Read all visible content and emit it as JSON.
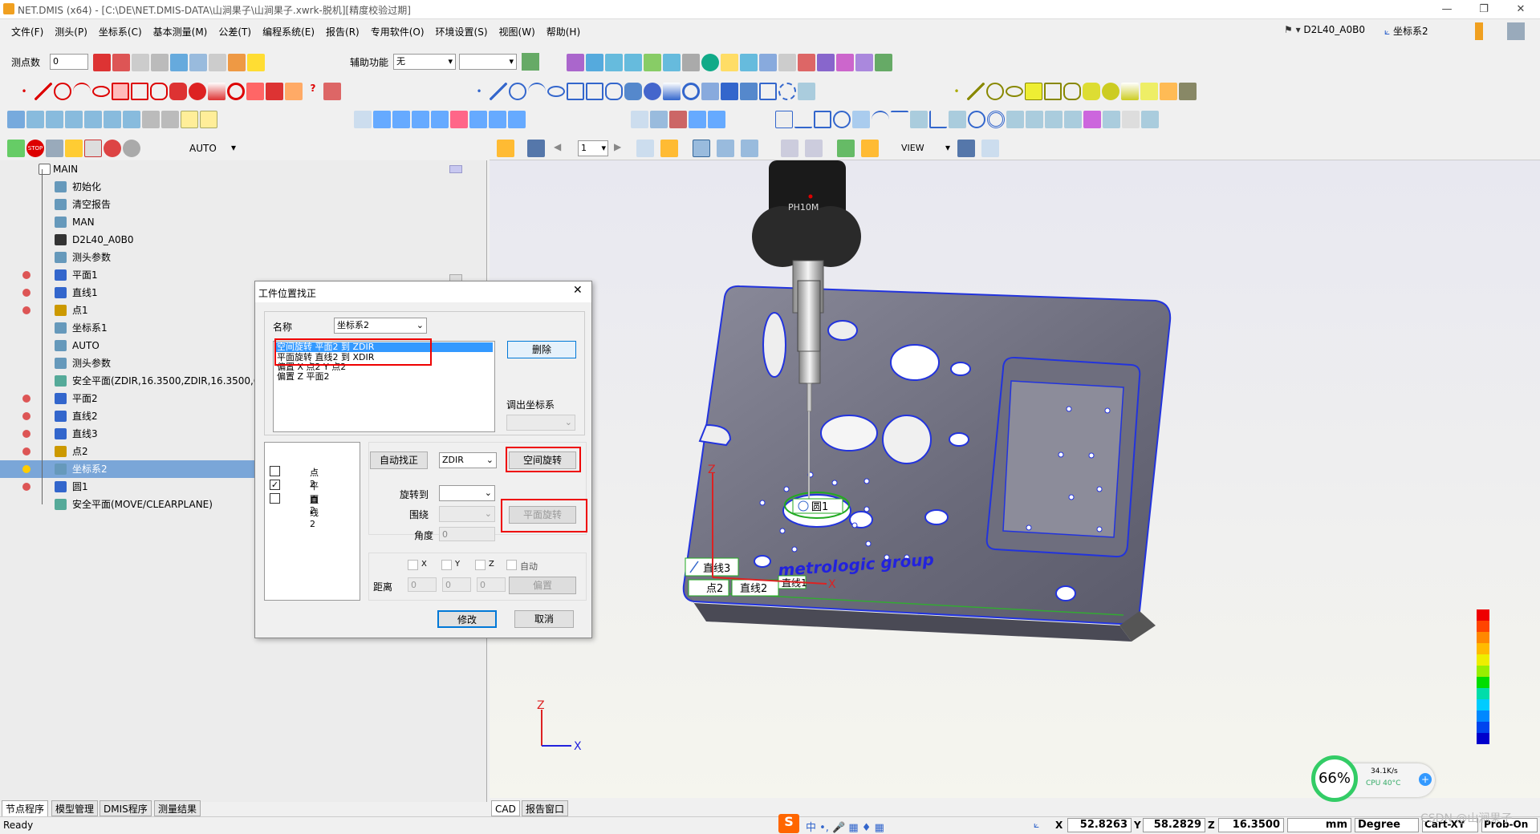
{
  "title": "NET.DMIS (x64) - [C:\\DE\\NET.DMIS-DATA\\山涧果子\\山涧果子.xwrk-脱机][精度校验过期]",
  "menu": [
    "文件(F)",
    "测头(P)",
    "坐标系(C)",
    "基本测量(M)",
    "公差(T)",
    "编程系统(E)",
    "报告(R)",
    "专用软件(O)",
    "环境设置(S)",
    "视图(W)",
    "帮助(H)"
  ],
  "toolbar": {
    "points_label": "测点数",
    "points_value": "0",
    "aux_label": "辅助功能",
    "aux_value": "无",
    "auto_value": "AUTO",
    "view_value": "VIEW",
    "page_value": "1"
  },
  "header_right": {
    "probe": "D2L40_A0B0",
    "coord_sys": "坐标系2"
  },
  "tree": [
    {
      "label": "MAIN",
      "sel": false
    },
    {
      "label": "初始化",
      "sel": false
    },
    {
      "label": "清空报告",
      "sel": false
    },
    {
      "label": "MAN",
      "sel": false
    },
    {
      "label": "D2L40_A0B0",
      "sel": false
    },
    {
      "label": "测头参数",
      "sel": false
    },
    {
      "label": "平面1",
      "sel": false
    },
    {
      "label": "直线1",
      "sel": false
    },
    {
      "label": "点1",
      "sel": false
    },
    {
      "label": "坐标系1",
      "sel": false
    },
    {
      "label": "AUTO",
      "sel": false
    },
    {
      "label": "测头参数",
      "sel": false
    },
    {
      "label": "安全平面(ZDIR,16.3500,ZDIR,16.3500,ON",
      "sel": false
    },
    {
      "label": "平面2",
      "sel": false
    },
    {
      "label": "直线2",
      "sel": false
    },
    {
      "label": "直线3",
      "sel": false
    },
    {
      "label": "点2",
      "sel": false
    },
    {
      "label": "坐标系2",
      "sel": true
    },
    {
      "label": "圆1",
      "sel": false
    },
    {
      "label": "安全平面(MOVE/CLEARPLANE)",
      "sel": false
    }
  ],
  "dialog": {
    "title": "工件位置找正",
    "name_label": "名称",
    "name_value": "坐标系2",
    "list": [
      "空间旋转 平面2 到 ZDIR",
      "平面旋转 直线2 到 XDIR",
      "偏置 X 点2 Y 点2",
      "偏置 Z 平面2"
    ],
    "delete": "删除",
    "recall_label": "调出坐标系",
    "features": [
      {
        "name": "点2",
        "checked": false
      },
      {
        "name": "平面2",
        "checked": true
      },
      {
        "name": "直线2",
        "checked": false
      }
    ],
    "auto_align": "自动找正",
    "dir_value": "ZDIR",
    "space_rotate": "空间旋转",
    "rotate_to": "旋转到",
    "around": "围绕",
    "plane_rotate": "平面旋转",
    "angle_label": "角度",
    "angle_value": "0",
    "cb_x": "X",
    "cb_y": "Y",
    "cb_z": "Z",
    "cb_auto": "自动",
    "distance_label": "距离",
    "dist_x": "0",
    "dist_y": "0",
    "dist_z": "0",
    "offset": "偏置",
    "modify": "修改",
    "cancel": "取消"
  },
  "cad_labels": {
    "circle1": "圆1",
    "line3": "直线3",
    "point2": "点2",
    "line2": "直线2",
    "line1": "直线1",
    "brand": "metrologic group",
    "probe_text": "PH10M",
    "axis_x": "X",
    "axis_y": "Y",
    "axis_z": "Z"
  },
  "bottom_tabs": [
    "节点程序",
    "模型管理",
    "DMIS程序",
    "测量结果"
  ],
  "cad_tabs": [
    "CAD",
    "报告窗口"
  ],
  "status": {
    "ready": "Ready",
    "x_label": "X",
    "x": "52.8263",
    "y_label": "Y",
    "y": "58.2829",
    "z_label": "Z",
    "z": "16.3500",
    "unit": "mm",
    "angle_unit": "Degree",
    "coord_mode": "Cart-XY",
    "probe_mode": "Prob-On"
  },
  "monitor": {
    "percent": "66%",
    "speed": "34.1K/s",
    "cpu": "CPU 40°C"
  },
  "watermark": "CSDN @山涧果子"
}
